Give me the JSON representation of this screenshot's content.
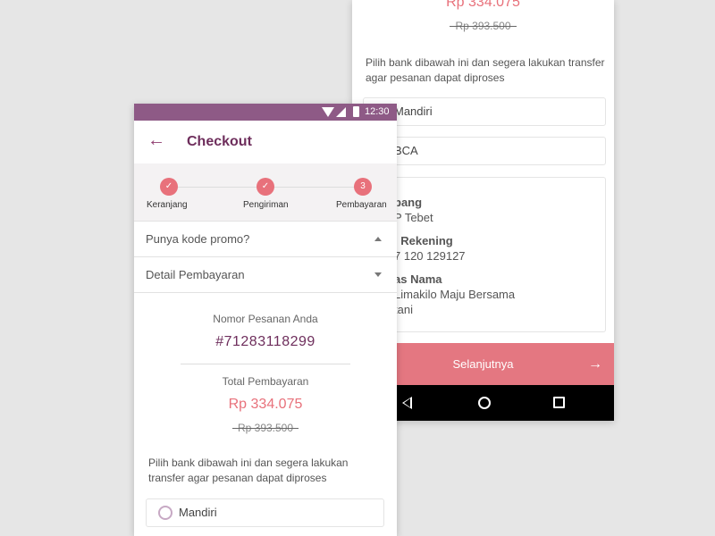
{
  "back": {
    "total_price": "Rp 334.075",
    "old_price": "Rp 393.500",
    "instruction": "Pilih bank dibawah ini dan segera lakukan transfer agar pesanan dapat diproses",
    "banks": [
      "Mandiri",
      "BCA"
    ],
    "detail": {
      "branch_label": "bang",
      "branch_value": "P Tebet",
      "account_label": ". Rekening",
      "account_value": "7 120 129127",
      "name_label": "as Nama",
      "name_value_1": "Limakilo Maju Bersama",
      "name_value_2": "tani"
    },
    "next_label": "Selanjutnya",
    "next_arrow": "→"
  },
  "front": {
    "status_time": "12:30",
    "back_arrow": "←",
    "title": "Checkout",
    "steps": [
      {
        "label": "Keranjang",
        "mark": "✓"
      },
      {
        "label": "Pengiriman",
        "mark": "✓"
      },
      {
        "label": "Pembayaran",
        "mark": "3"
      }
    ],
    "promo_label": "Punya kode promo?",
    "detail_label": "Detail Pembayaran",
    "order_label": "Nomor Pesanan Anda",
    "order_number": "#71283118299",
    "total_label": "Total Pembayaran",
    "total_price": "Rp 334.075",
    "old_price": "Rp 393.500",
    "instruction": "Pilih bank dibawah ini dan segera lakukan transfer agar pesanan dapat diproses",
    "bank_first": "Mandiri"
  },
  "colors": {
    "accent": "#e8717b",
    "brand": "#8e5a86",
    "title": "#6e2e5c"
  }
}
